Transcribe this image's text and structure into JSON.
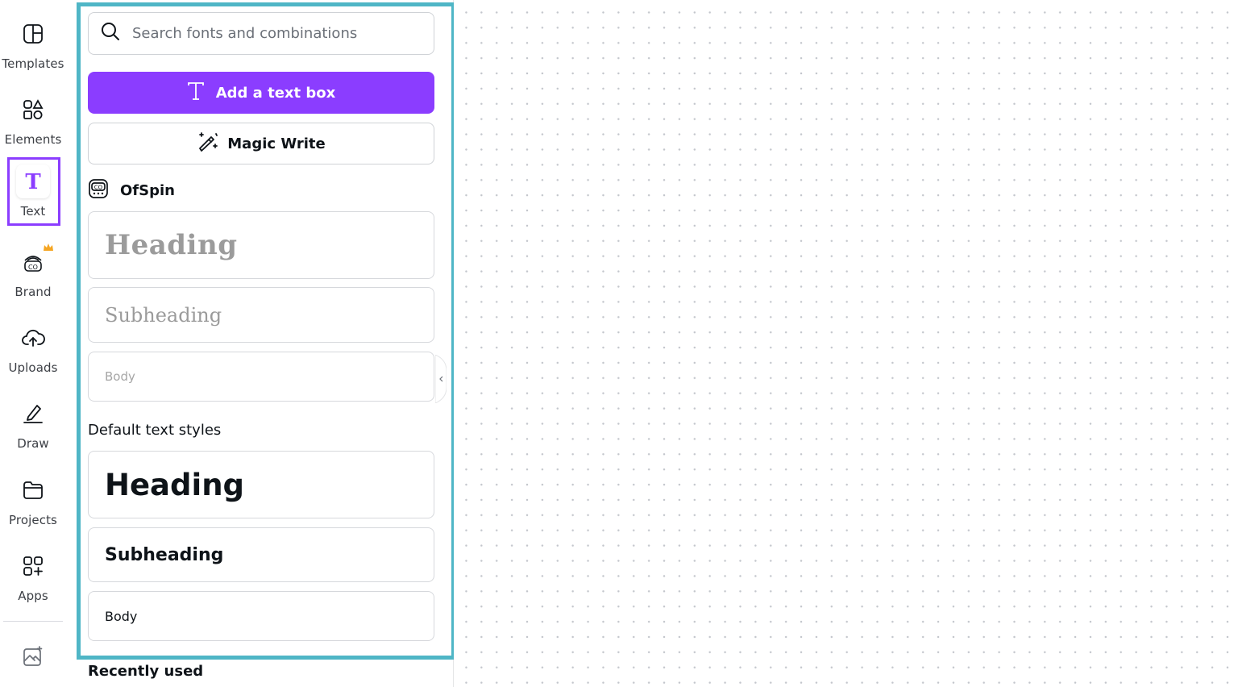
{
  "sidebar": {
    "items": [
      {
        "label": "Templates",
        "icon": "templates-icon"
      },
      {
        "label": "Elements",
        "icon": "elements-icon"
      },
      {
        "label": "Text",
        "icon": "text-icon",
        "active": true
      },
      {
        "label": "Brand",
        "icon": "brand-icon",
        "badge": "crown-icon"
      },
      {
        "label": "Uploads",
        "icon": "upload-cloud-icon"
      },
      {
        "label": "Draw",
        "icon": "draw-icon"
      },
      {
        "label": "Projects",
        "icon": "folder-icon"
      },
      {
        "label": "Apps",
        "icon": "apps-icon"
      },
      {
        "label": "",
        "icon": "magic-media-icon"
      }
    ],
    "active_color": "#8b3dff"
  },
  "panel": {
    "search": {
      "placeholder": "Search fonts and combinations",
      "value": ""
    },
    "add_text_box_label": "Add a text box",
    "magic_write_label": "Magic Write",
    "brand_kit_name": "OfSpin",
    "brand_styles": {
      "heading": "Heading",
      "subheading": "Subheading",
      "body": "Body"
    },
    "default_styles_title": "Default text styles",
    "default_styles": {
      "heading": "Heading",
      "subheading": "Subheading",
      "body": "Body"
    },
    "recently_used_title": "Recently used"
  },
  "colors": {
    "accent": "#8b3dff",
    "highlight": "#4fb6c6",
    "crown": "#f5a623"
  }
}
